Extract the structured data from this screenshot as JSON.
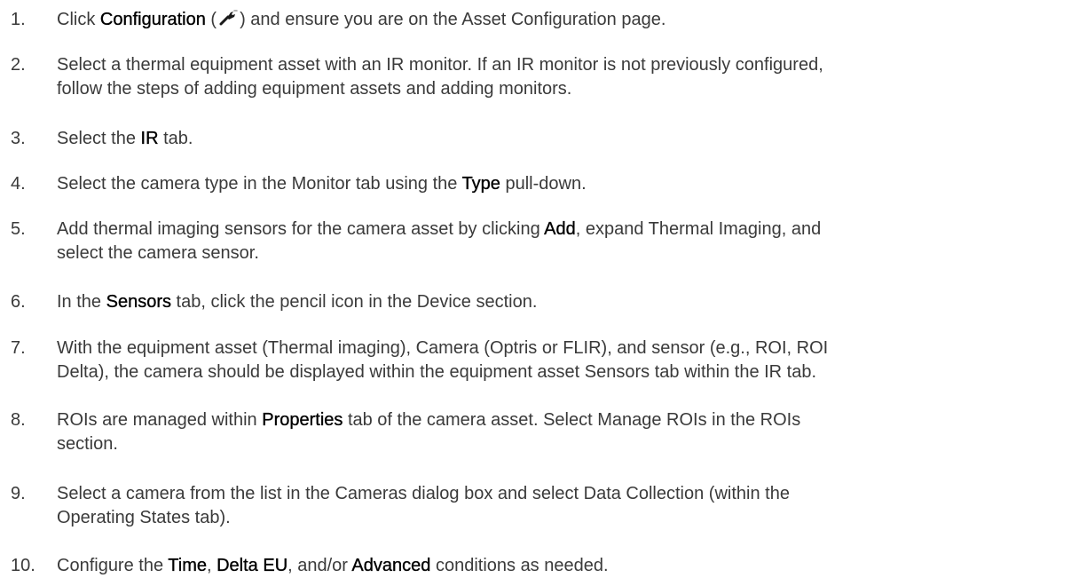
{
  "steps": [
    {
      "num": "1.",
      "t1": "Click ",
      "b1": "Configuration",
      "t2": " (",
      "icon": "wrench-icon",
      "t3": ") and ensure you are on the Asset Configuration page."
    },
    {
      "num": "2.",
      "line1": "Select a thermal equipment asset with an IR monitor. If an IR monitor is not previously configured,",
      "line2": "follow the steps of adding equipment assets and adding monitors."
    },
    {
      "num": "3.",
      "t1": "Select the ",
      "b1": "IR",
      "t2": " tab."
    },
    {
      "num": "4.",
      "t1": "Select the camera type in the Monitor tab using the ",
      "b1": "Type",
      "t2": " pull-down."
    },
    {
      "num": "5.",
      "t1": "Add thermal imaging sensors for the camera asset by clicking ",
      "b1": "Add",
      "t2": ", expand Thermal Imaging, and",
      "line2": "select the camera sensor."
    },
    {
      "num": "6.",
      "t1": "In the ",
      "b1": "Sensors",
      "t2": " tab, click the pencil icon in the Device section."
    },
    {
      "num": "7.",
      "line1": "With the equipment asset (Thermal imaging), Camera (Optris or FLIR), and sensor (e.g., ROI, ROI",
      "line2": "Delta), the camera should be displayed within the equipment asset Sensors tab within the IR tab."
    },
    {
      "num": "8.",
      "t1": "ROIs are managed within ",
      "b1": "Properties",
      "t2": " tab of the camera asset. Select Manage ROIs in the ROIs",
      "line2": "section."
    },
    {
      "num": "9.",
      "line1": "Select a camera from the list in the Cameras dialog box and select Data Collection (within the",
      "line2": "Operating States tab)."
    },
    {
      "num": "10.",
      "t1": "Configure the ",
      "b1": "Time",
      "t2": ", ",
      "b2": "Delta EU",
      "t3": ", and/or ",
      "b3": "Advanced",
      "t4": " conditions as needed."
    }
  ]
}
